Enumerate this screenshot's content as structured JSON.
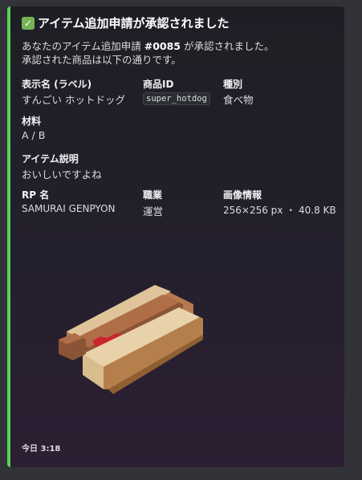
{
  "embed": {
    "title_icon": "check-mark-button-icon",
    "title": "アイテム追加申請が承認されました",
    "description": {
      "line1_prefix": "あなたのアイテム追加申請 ",
      "request_id": "#0085",
      "line1_suffix": " が承認されました。",
      "line2": "承認された商品は以下の通りです。"
    },
    "fields": {
      "display_name": {
        "name": "表示名 (ラベル)",
        "value": "すんごい ホットドッグ"
      },
      "product_id": {
        "name": "商品ID",
        "value": "super_hotdog"
      },
      "category": {
        "name": "種別",
        "value": "食べ物"
      },
      "materials": {
        "name": "材料",
        "value": "A / B"
      },
      "description": {
        "name": "アイテム説明",
        "value": "おいしいですよね"
      },
      "rp_name": {
        "name": "RP 名",
        "value": "SAMURAI GENPYON"
      },
      "job": {
        "name": "職業",
        "value": "運営"
      },
      "image_info": {
        "name": "画像情報",
        "value": "256×256 px ・ 40.8 KB"
      }
    },
    "image_subject": "voxel-hotdog-image",
    "footer": {
      "timestamp": "今日 3:18"
    },
    "accent_color": "#57d35a"
  }
}
